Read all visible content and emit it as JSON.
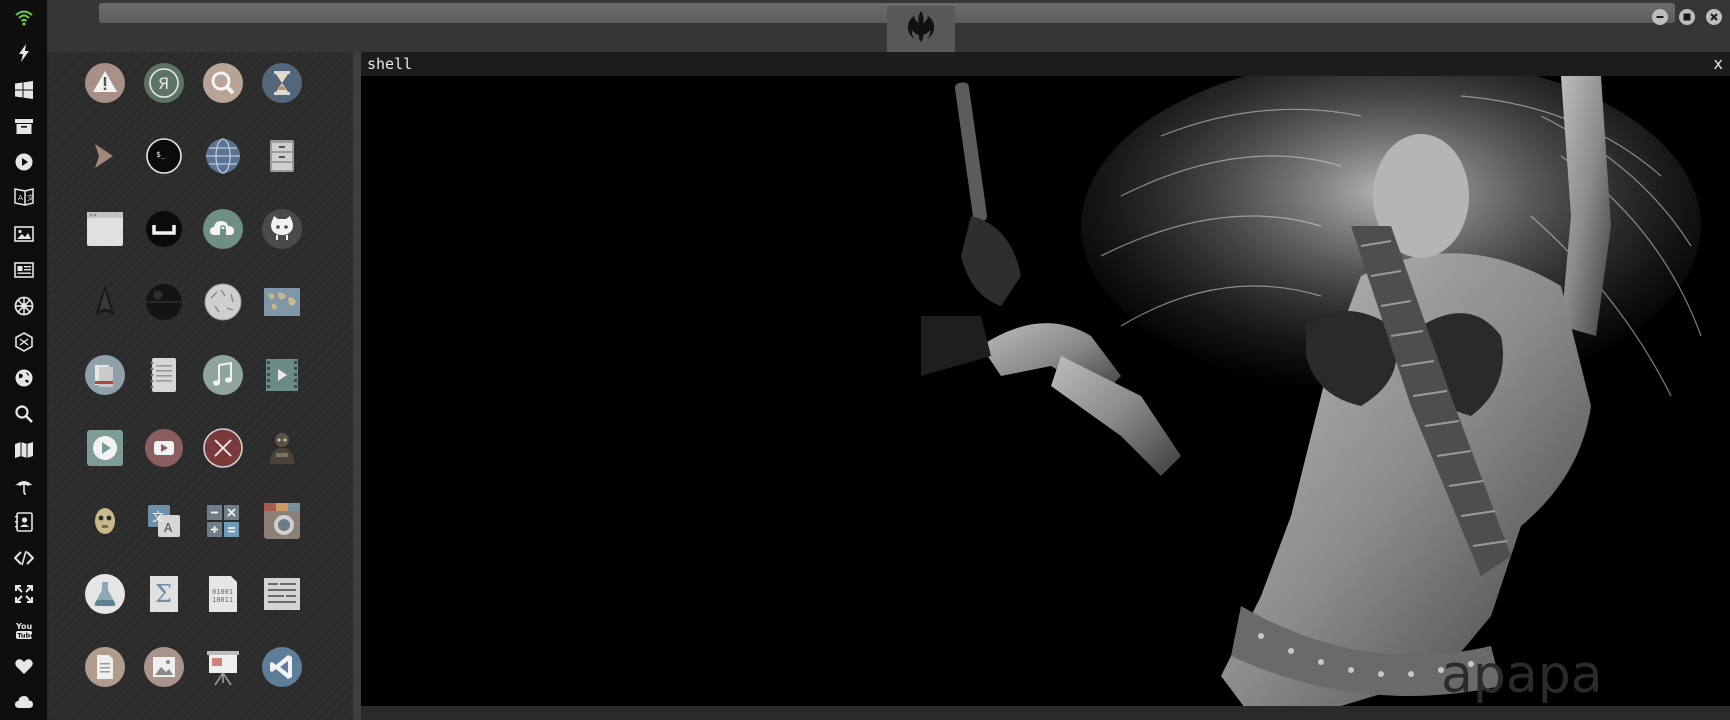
{
  "dock": {
    "items": [
      {
        "name": "wifi-icon",
        "color": "#6fcf45"
      },
      {
        "name": "flash-icon"
      },
      {
        "name": "windows-icon"
      },
      {
        "name": "archive-icon"
      },
      {
        "name": "play-icon"
      },
      {
        "name": "translate-icon"
      },
      {
        "name": "image-icon"
      },
      {
        "name": "news-icon"
      },
      {
        "name": "galactic-empire-icon"
      },
      {
        "name": "hexagon-icon"
      },
      {
        "name": "globe-icon"
      },
      {
        "name": "search-icon"
      },
      {
        "name": "map-icon"
      },
      {
        "name": "umbrella-icon"
      },
      {
        "name": "contacts-icon"
      },
      {
        "name": "code-icon"
      },
      {
        "name": "fullscreen-icon"
      },
      {
        "name": "youtube-icon"
      },
      {
        "name": "heart-icon"
      },
      {
        "name": "cloud-icon"
      }
    ]
  },
  "topbar": {
    "center_tab_icon": "rebel-alliance-icon",
    "window_controls": [
      "minimize-icon",
      "maximize-icon",
      "close-icon"
    ]
  },
  "apps": {
    "icons": [
      "warning-icon",
      "yandex-icon",
      "search-icon",
      "hourglass-icon",
      "terminal-chevron-icon",
      "terminal-icon",
      "globe-icon",
      "file-cabinet-icon",
      "browser-window-icon",
      "bracket-icon",
      "cloud-lock-icon",
      "github-octocat-icon",
      "starfleet-icon",
      "death-star-icon",
      "wikipedia-icon",
      "world-map-icon",
      "books-icon",
      "notebook-icon",
      "music-icon",
      "video-icon",
      "video-player-icon",
      "youtube-player-icon",
      "close-circle-icon",
      "stormtrooper-icon",
      "c3po-icon",
      "language-translate-icon",
      "calculator-icon",
      "camera-icon",
      "chemistry-flask-icon",
      "math-sigma-icon",
      "binary-file-icon",
      "text-editor-icon",
      "document-icon",
      "picture-icon",
      "presentation-icon",
      "visual-studio-icon"
    ]
  },
  "shell": {
    "title": "shell",
    "close_label": "x"
  },
  "wallpaper": {
    "description_icon": "wallpaper-image",
    "watermark": "apapa"
  },
  "colors": {
    "dock_bg": "#0e0e0e",
    "panel_bg": "#2c2c2c",
    "shell_bg": "#000000",
    "accent_green": "#6fcf45"
  }
}
